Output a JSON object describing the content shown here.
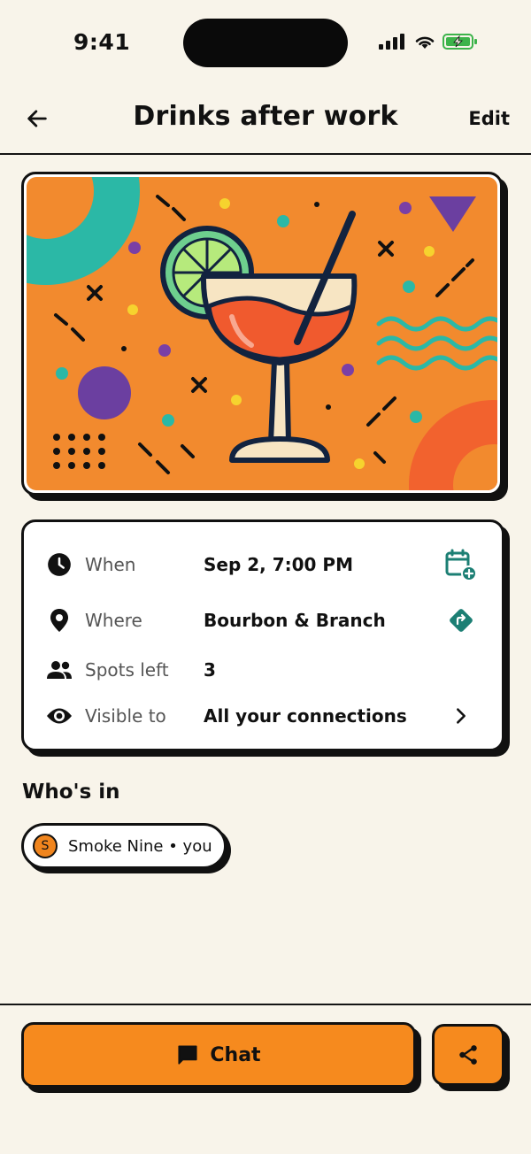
{
  "status_bar": {
    "time": "9:41",
    "icons": [
      "signal-icon",
      "wifi-icon",
      "battery-charging-icon"
    ]
  },
  "header": {
    "back_icon": "arrow-left-icon",
    "title": "Drinks after work",
    "edit_label": "Edit"
  },
  "hero": {
    "image": "cocktail-illustration"
  },
  "details": {
    "rows": [
      {
        "icon": "clock-icon",
        "label": "When",
        "value": "Sep 2, 7:00 PM",
        "action_icon": "calendar-add-icon"
      },
      {
        "icon": "location-pin-icon",
        "label": "Where",
        "value": "Bourbon & Branch",
        "action_icon": "directions-icon"
      },
      {
        "icon": "people-icon",
        "label": "Spots left",
        "value": "3"
      },
      {
        "icon": "eye-icon",
        "label": "Visible to",
        "value": "All your connections",
        "action_icon": "chevron-right-icon"
      }
    ]
  },
  "whos_in": {
    "title": "Who's in",
    "attendees": [
      {
        "initial": "S",
        "label": "Smoke Nine • you"
      }
    ]
  },
  "footer": {
    "chat_label": "Chat",
    "chat_icon": "chat-bubble-icon",
    "share_icon": "share-icon"
  },
  "colors": {
    "background": "#f8f4ea",
    "accent_orange": "#f68a1e",
    "teal": "#2bb8a6",
    "purple": "#6b3fa0",
    "action_teal": "#1c7f74"
  }
}
